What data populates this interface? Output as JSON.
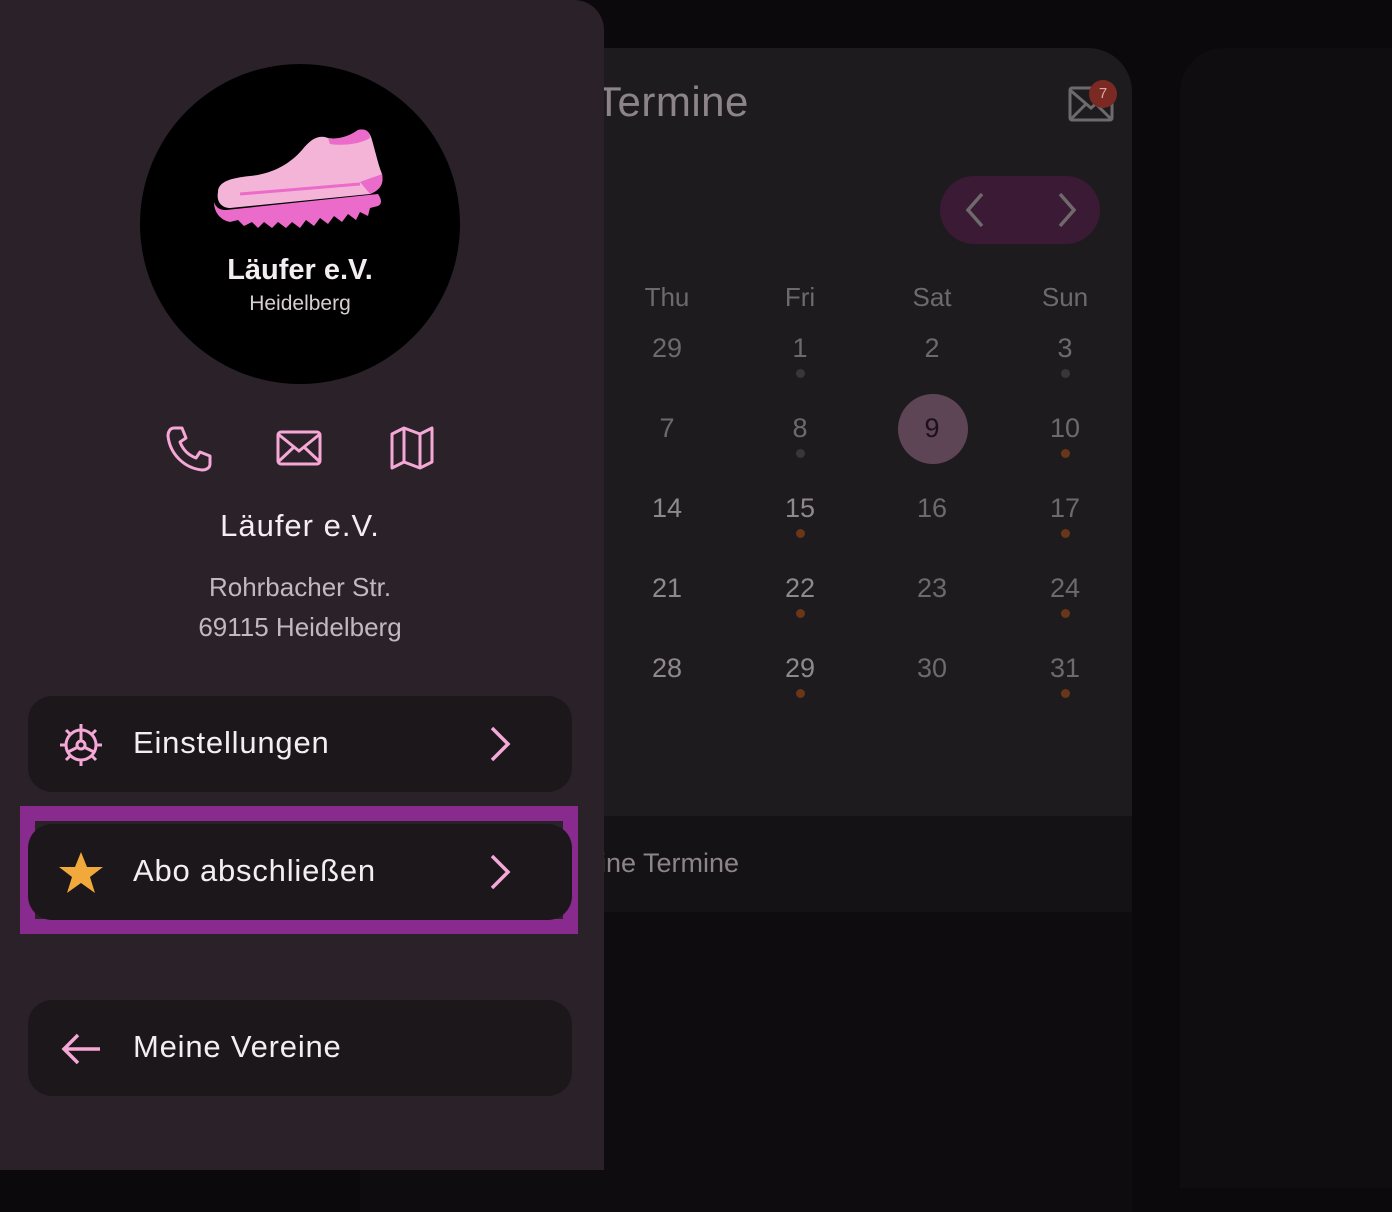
{
  "calendar": {
    "title": "Termine",
    "unread_count": "7",
    "weekdays": [
      "Thu",
      "Fri",
      "Sat",
      "Sun"
    ],
    "weeks": [
      [
        "29",
        "1",
        "2",
        "3"
      ],
      [
        "7",
        "8",
        "9",
        "10"
      ],
      [
        "14",
        "15",
        "16",
        "17"
      ],
      [
        "21",
        "22",
        "23",
        "24"
      ],
      [
        "28",
        "29",
        "30",
        "31"
      ]
    ],
    "selected_day": "9",
    "list_label": "ine Termine"
  },
  "drawer": {
    "logo": {
      "name": "Läufer e.V.",
      "city": "Heidelberg"
    },
    "actions": [
      "phone-icon",
      "mail-icon",
      "map-icon"
    ],
    "club_name": "Läufer e.V.",
    "address_line1": "Rohrbacher Str.",
    "address_line2": "69115 Heidelberg",
    "menu": {
      "settings": "Einstellungen",
      "subscribe": "Abo abschließen",
      "my_clubs": "Meine Vereine"
    }
  },
  "colors": {
    "accent_pink": "#f5a8d6",
    "star": "#f0a93a",
    "highlight": "#892a8e"
  }
}
